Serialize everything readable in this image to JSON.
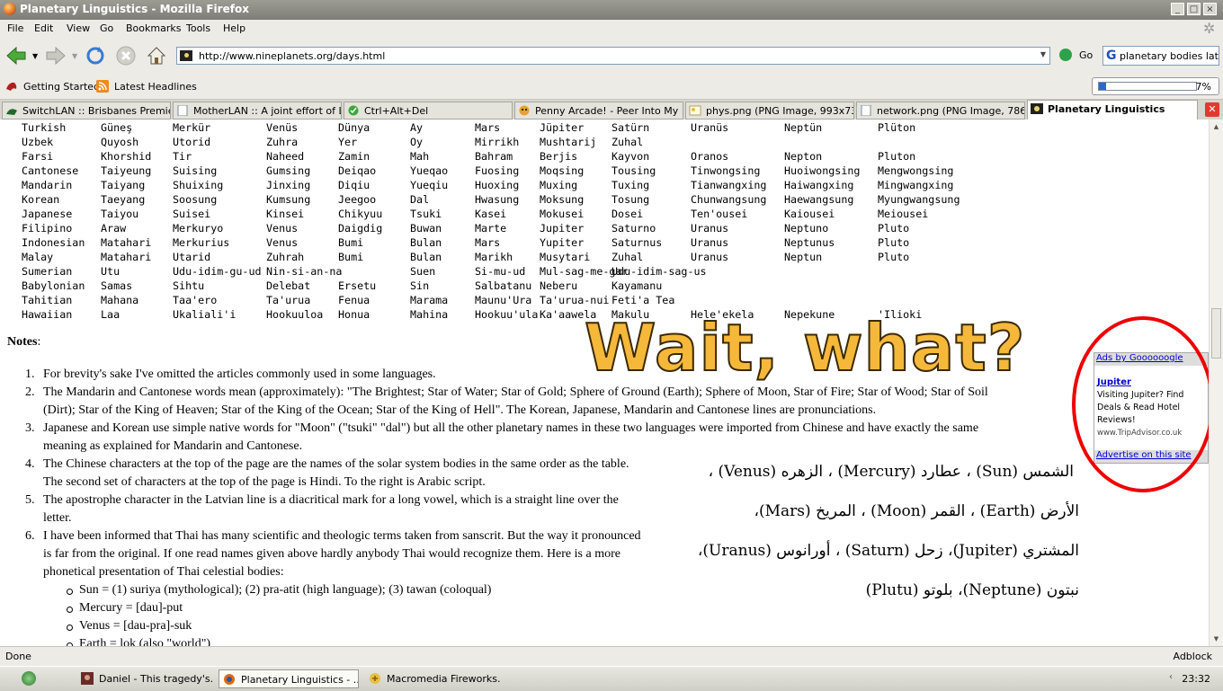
{
  "window": {
    "title": "Planetary Linguistics - Mozilla Firefox"
  },
  "menu": [
    "File",
    "Edit",
    "View",
    "Go",
    "Bookmarks",
    "Tools",
    "Help"
  ],
  "nav": {
    "url": "http://www.nineplanets.org/days.html",
    "go_label": "Go",
    "search_value": "planetary bodies latin"
  },
  "bookmarks": {
    "getting_started": "Getting Started",
    "latest_headlines": "Latest Headlines",
    "progress_text": "7%",
    "progress_fraction": 0.07
  },
  "tabs": [
    "SwitchLAN :: Brisbanes Premier...",
    "MotherLAN :: A joint effort of L...",
    "Ctrl+Alt+Del",
    "Penny Arcade! - Peer Into My ...",
    "phys.png (PNG Image, 993x73...",
    "network.png (PNG Image, 786...",
    "Planetary Linguistics"
  ],
  "table_rows": [
    [
      "Turkish",
      "Güneş",
      "Merkür",
      "Venüs",
      "Dünya",
      "Ay",
      "Mars",
      "Jüpiter",
      "Satürn",
      "Uranüs",
      "Neptün",
      "Plüton"
    ],
    [
      "Uzbek",
      "Quyosh",
      "Utorid",
      "Zuhra",
      "Yer",
      "Oy",
      "Mirrikh",
      "Mushtarij",
      "Zuhal",
      "",
      "",
      ""
    ],
    [
      "Farsi",
      "Khorshid",
      "Tir",
      "Naheed",
      "Zamin",
      "Mah",
      "Bahram",
      "Berjis",
      "Kayvon",
      "Oranos",
      "Nepton",
      "Pluton"
    ],
    [
      "Cantonese",
      "Taiyeung",
      "Suising",
      "Gumsing",
      "Deiqao",
      "Yueqao",
      "Fuosing",
      "Moqsing",
      "Tousing",
      "Tinwongsing",
      "Huoiwongsing",
      "Mengwongsing"
    ],
    [
      "Mandarin",
      "Taiyang",
      "Shuixing",
      "Jinxing",
      "Diqiu",
      "Yueqiu",
      "Huoxing",
      "Muxing",
      "Tuxing",
      "Tianwangxing",
      "Haiwangxing",
      "Mingwangxing"
    ],
    [
      "Korean",
      "Taeyang",
      "Soosung",
      "Kumsung",
      "Jeegoo",
      "Dal",
      "Hwasung",
      "Moksung",
      "Tosung",
      "Chunwangsung",
      "Haewangsung",
      "Myungwangsung"
    ],
    [
      "Japanese",
      "Taiyou",
      "Suisei",
      "Kinsei",
      "Chikyuu",
      "Tsuki",
      "Kasei",
      "Mokusei",
      "Dosei",
      "Ten'ousei",
      "Kaiousei",
      "Meiousei"
    ],
    [
      "Filipino",
      "Araw",
      "Merkuryo",
      "Venus",
      "Daigdig",
      "Buwan",
      "Marte",
      "Jupiter",
      "Saturno",
      "Uranus",
      "Neptuno",
      "Pluto"
    ],
    [
      "Indonesian",
      "Matahari",
      "Merkurius",
      "Venus",
      "Bumi",
      "Bulan",
      "Mars",
      "Yupiter",
      "Saturnus",
      "Uranus",
      "Neptunus",
      "Pluto"
    ],
    [
      "Malay",
      "Matahari",
      "Utarid",
      "Zuhrah",
      "Bumi",
      "Bulan",
      "Marikh",
      "Musytari",
      "Zuhal",
      "Uranus",
      "Neptun",
      "Pluto"
    ],
    [
      "Sumerian",
      "Utu",
      "Udu-idim-gu-ud",
      "Nin-si-an-na",
      "",
      "Suen",
      "Si-mu-ud",
      "Mul-sag-me-gar",
      "Udu-idim-sag-us",
      "",
      "",
      ""
    ],
    [
      "Babylonian",
      "Samas",
      "Sihtu",
      "Delebat",
      "Ersetu",
      "Sin",
      "Salbatanu",
      "Neberu",
      "Kayamanu",
      "",
      "",
      ""
    ],
    [
      "Tahitian",
      "Mahana",
      "Taa'ero",
      "Ta'urua",
      "Fenua",
      "Marama",
      "Maunu'Ura",
      "Ta'urua-nui",
      "Feti'a Tea",
      "",
      "",
      ""
    ],
    [
      "Hawaiian",
      "Laa",
      "Ukaliali'i",
      "Hookuuloa",
      "Honua",
      "Mahina",
      "Hookuu'ula",
      "Ka'aawela",
      "Makulu",
      "Hele'ekela",
      "Nepekune",
      "'Ilioki"
    ]
  ],
  "notes_heading": "Notes",
  "notes": [
    {
      "n": "1.",
      "lines": [
        "For brevity's sake I've omitted the articles commonly used in some languages."
      ]
    },
    {
      "n": "2.",
      "lines": [
        "The Mandarin and Cantonese words mean (approximately): \"The Brightest; Star of Water; Star of Gold; Sphere of Ground (Earth); Sphere of Moon, Star of Fire; Star of Wood; Star of Soil",
        "(Dirt); Star of the King of Heaven; Star of the King of the Ocean; Star of the King of Hell\". The Korean, Japanese, Mandarin and Cantonese lines are pronunciations."
      ]
    },
    {
      "n": "3.",
      "lines": [
        "Japanese and Korean use simple native words for \"Moon\" (\"tsuki\" \"dal\") but all the other planetary names in these two languages were imported from Chinese and have exactly the same",
        "meaning as explained for Mandarin and Cantonese."
      ]
    },
    {
      "n": "4.",
      "lines": [
        "The Chinese characters at the top of the page are the names of the solar system bodies in the same order as the table.",
        "The second set of characters at the top of the page is Hindi. To the right is Arabic script."
      ]
    },
    {
      "n": "5.",
      "lines": [
        "The apostrophe character in the Latvian line is a diacritical mark for a long vowel, which is a straight line over the",
        "letter."
      ]
    },
    {
      "n": "6.",
      "lines": [
        "I have been informed that Thai has many scientific and theologic terms taken from sanscrit. But the way it pronounced",
        "is far from the original. If one read names given above hardly anybody Thai would recognize them. Here is a more",
        "phonetical presentation of Thai celestial bodies:"
      ]
    }
  ],
  "subnotes": [
    "Sun = (1) suriya (mythological); (2) pra-atit (high language); (3) tawan (coloqual)",
    "Mercury = [dau]-put",
    "Venus = [dau-pra]-suk",
    "Earth = lok (also \"world\")"
  ],
  "overlay_text": "Wait, what?",
  "arabic_lines": [
    "الشمس (Sun)   ،   عطارد (Mercury) ، الزهره (Venus) ،",
    "الأرض (Earth) ، القمر (Moon) ، المريخ (Mars)،",
    "المشتري (Jupiter)، زحل (Saturn) ، أورانوس (Uranus)،",
    "نبتون (Neptune)، بلوتو (Plutu)"
  ],
  "ad": {
    "header": "Ads by Goooooogle",
    "title": "Jupiter",
    "body": "Visiting Jupiter? Find Deals & Read Hotel Reviews!",
    "url": "www.TripAdvisor.co.uk",
    "footer": "Advertise on this site"
  },
  "status": {
    "left": "Done",
    "right": "Adblock"
  },
  "taskbar": {
    "items": [
      "Daniel - This tragedy's...",
      "Planetary Linguistics - ...",
      "Macromedia Fireworks..."
    ],
    "clock": "23:32"
  },
  "colors": {
    "overlay": "#f5b83a",
    "circle": "#e00000",
    "accent": "#2e68c8"
  }
}
